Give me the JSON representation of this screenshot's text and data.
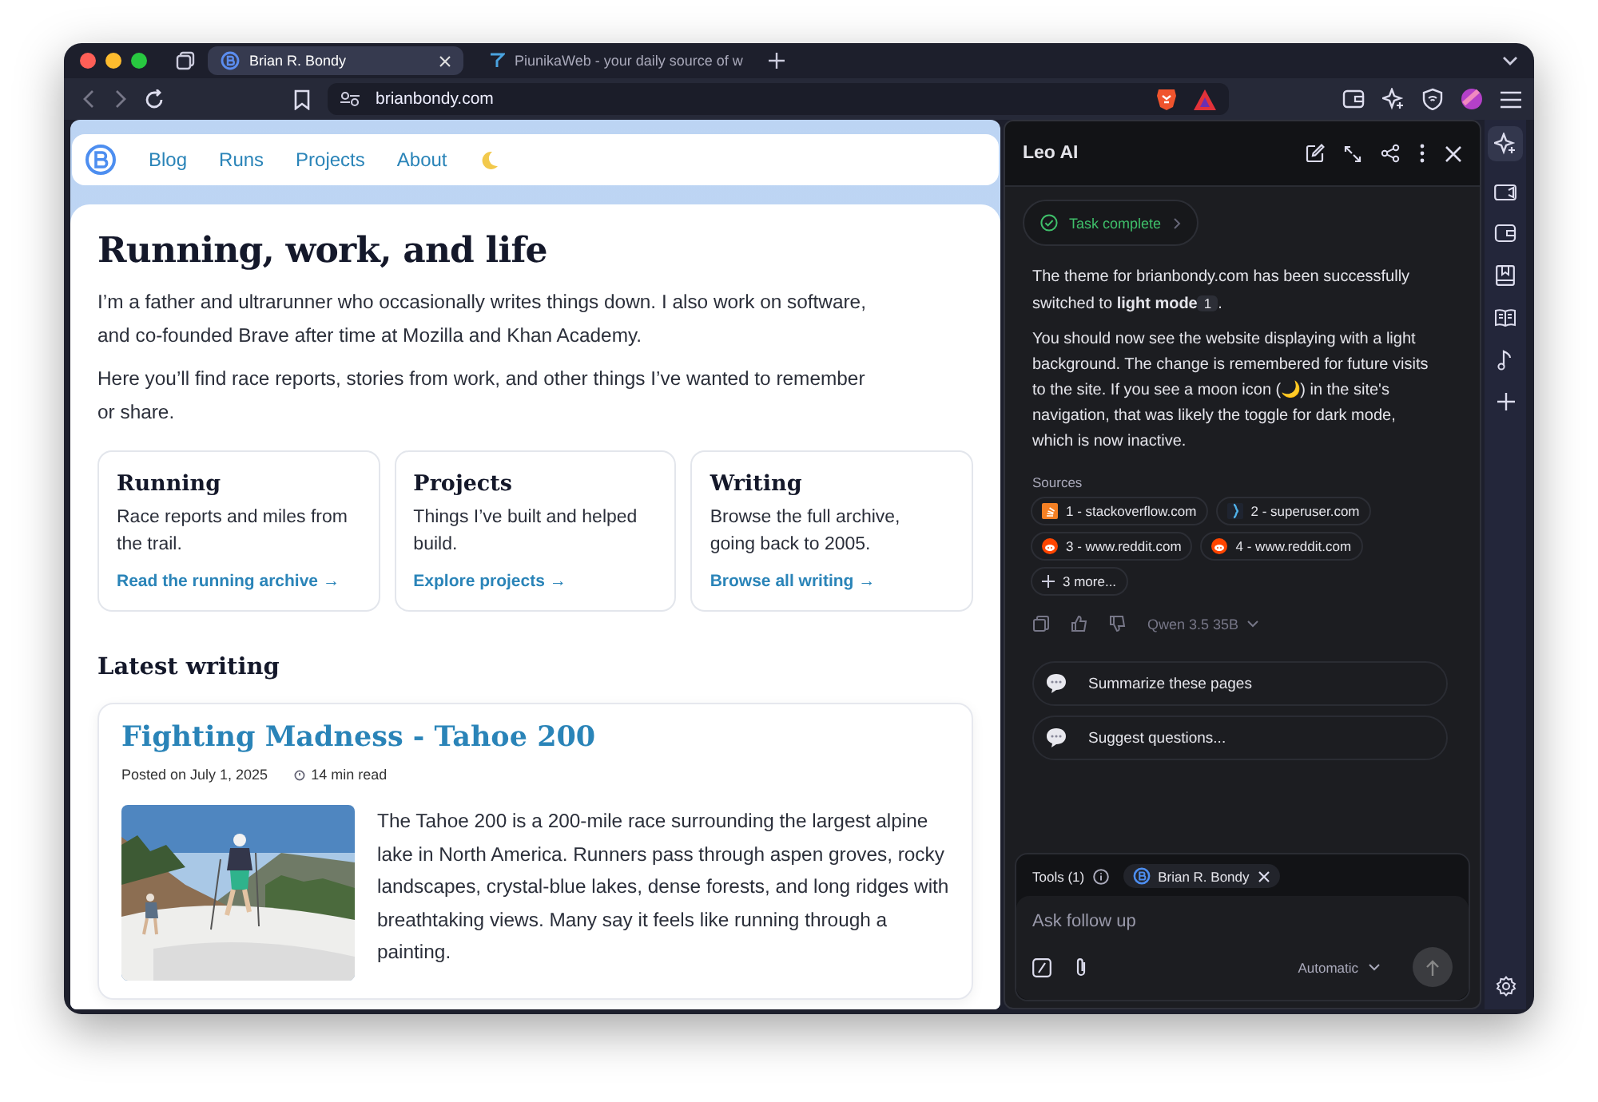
{
  "browser": {
    "tabs": [
      {
        "title": "Brian R. Bondy",
        "selected": true
      },
      {
        "title": "PiunikaWeb - your daily source of w",
        "selected": false
      }
    ],
    "url": "brianbondy.com"
  },
  "page": {
    "nav": [
      {
        "label": "Blog"
      },
      {
        "label": "Runs"
      },
      {
        "label": "Projects"
      },
      {
        "label": "About"
      }
    ],
    "heading": "Running, work, and life",
    "intro": [
      "I’m a father and ultrarunner who occasionally writes things down. I also work on software, and co-founded Brave after time at Mozilla and Khan Academy.",
      "Here you’ll find race reports, stories from work, and other things I’ve wanted to remember or share."
    ],
    "cards": [
      {
        "title": "Running",
        "text": "Race reports and miles from the trail.",
        "link": "Read the running archive →"
      },
      {
        "title": "Projects",
        "text": "Things I’ve built and helped build.",
        "link": "Explore projects →"
      },
      {
        "title": "Writing",
        "text": "Browse the full archive, going back to 2005.",
        "link": "Browse all writing →"
      }
    ],
    "latest_heading": "Latest writing",
    "post": {
      "title": "Fighting Madness - Tahoe 200",
      "date": "Posted on July 1, 2025",
      "read_time": "14 min read",
      "excerpt": "The Tahoe 200 is a 200-mile race surrounding the largest alpine lake in North America. Runners pass through aspen groves, rocky landscapes, crystal-blue lakes, dense forests, and long ridges with breathtaking views. Many say it feels like running through a painting."
    }
  },
  "leo": {
    "title": "Leo AI",
    "status": "Task complete",
    "message": [
      {
        "text": "The theme for brianbondy.com has been successfully switched to **light mode**",
        "citation": "1",
        "after": "."
      },
      {
        "text": "You should now see the website displaying with a light background. The change is remembered for future visits to the site. If you see a moon icon (🌙) in the site's navigation, that was likely the toggle for dark mode, which is now inactive."
      }
    ],
    "sources_label": "Sources",
    "sources": [
      {
        "label": "1 - stackoverflow.com",
        "kind": "stack"
      },
      {
        "label": "2 - superuser.com",
        "kind": "brace"
      },
      {
        "label": "3 - www.reddit.com",
        "kind": "reddit"
      },
      {
        "label": "4 - www.reddit.com",
        "kind": "reddit"
      }
    ],
    "more": "3 more...",
    "model": "Qwen 3.5 35B",
    "suggestions": [
      "Summarize these pages",
      "Suggest questions..."
    ],
    "tools_label": "Tools (1)",
    "tool": "Brian R. Bondy",
    "placeholder": "Ask follow up",
    "mode": "Automatic"
  }
}
